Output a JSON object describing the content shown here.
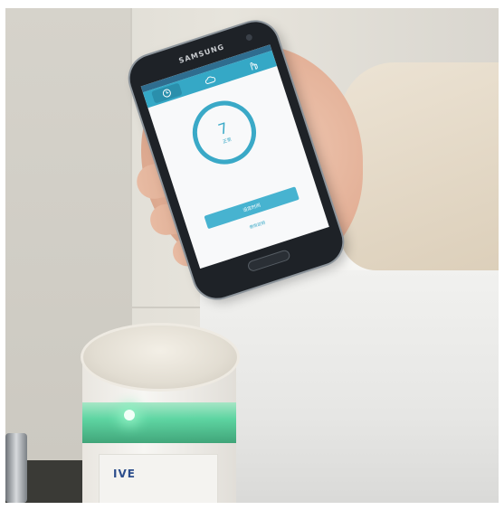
{
  "phone": {
    "brand": "SAMSUNG",
    "tabs": [
      {
        "icon": "clock-icon",
        "active": true
      },
      {
        "icon": "cloud-icon",
        "active": false
      },
      {
        "icon": "hand-icon",
        "active": false
      }
    ],
    "counter_value": "7",
    "counter_label": "正常",
    "action_button_label": "设定时间",
    "sub_link_label": "使用说明"
  },
  "device": {
    "logo_text": "IVE"
  },
  "colors": {
    "accent": "#3aa9c7",
    "tabbar": "#35a8c6",
    "led_glow": "#4fd39b"
  }
}
